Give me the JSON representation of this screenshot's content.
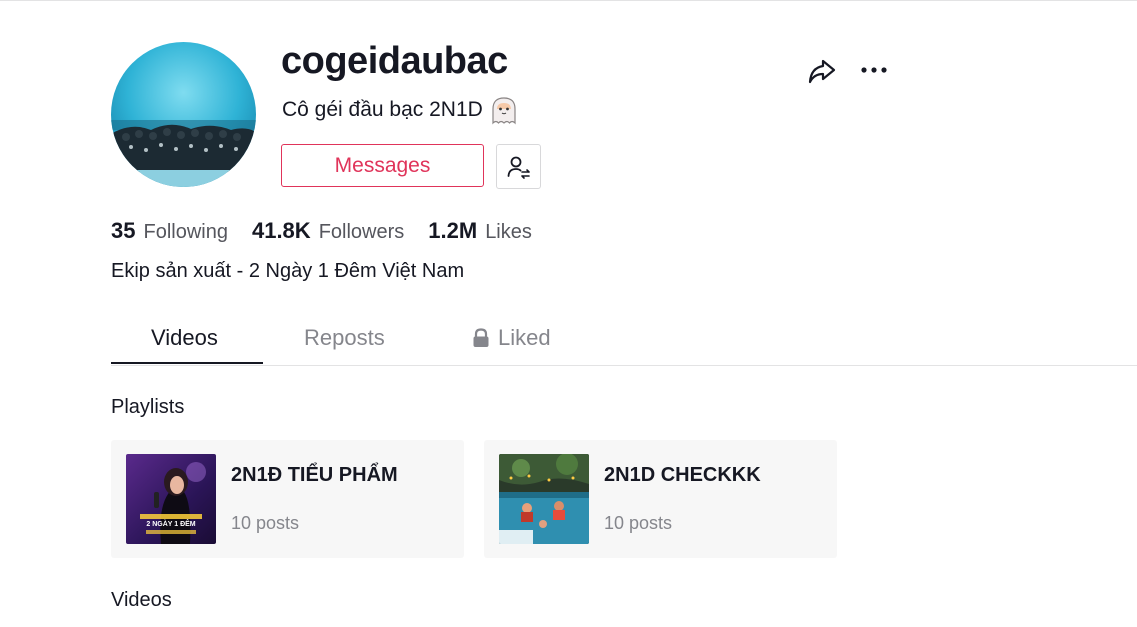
{
  "profile": {
    "username": "cogeidaubac",
    "nickname": "Cô géi đầu bạc 2N1D",
    "nickname_emoji": "ghost-face-emoji",
    "messages_label": "Messages",
    "bio": "Ekip sản xuất - 2 Ngày 1 Đêm Việt Nam"
  },
  "stats": {
    "following_count": "35",
    "following_label": "Following",
    "followers_count": "41.8K",
    "followers_label": "Followers",
    "likes_count": "1.2M",
    "likes_label": "Likes"
  },
  "tabs": [
    {
      "label": "Videos",
      "active": true
    },
    {
      "label": "Reposts",
      "active": false
    },
    {
      "label": "Liked",
      "active": false,
      "icon": "lock-icon"
    }
  ],
  "sections": {
    "playlists_title": "Playlists",
    "videos_title": "Videos"
  },
  "playlists": [
    {
      "name": "2N1Đ TIỂU PHẨM",
      "count": "10 posts",
      "thumb_caption_1": "2 NGÀY 1 ĐÊM"
    },
    {
      "name": "2N1D CHECKKK",
      "count": "10 posts"
    }
  ],
  "colors": {
    "accent": "#e0345a",
    "text": "#161823",
    "muted": "#85868c"
  },
  "icons": {
    "share": "share-arrow-icon",
    "more": "more-dots-icon",
    "friend": "person-swap-icon"
  }
}
